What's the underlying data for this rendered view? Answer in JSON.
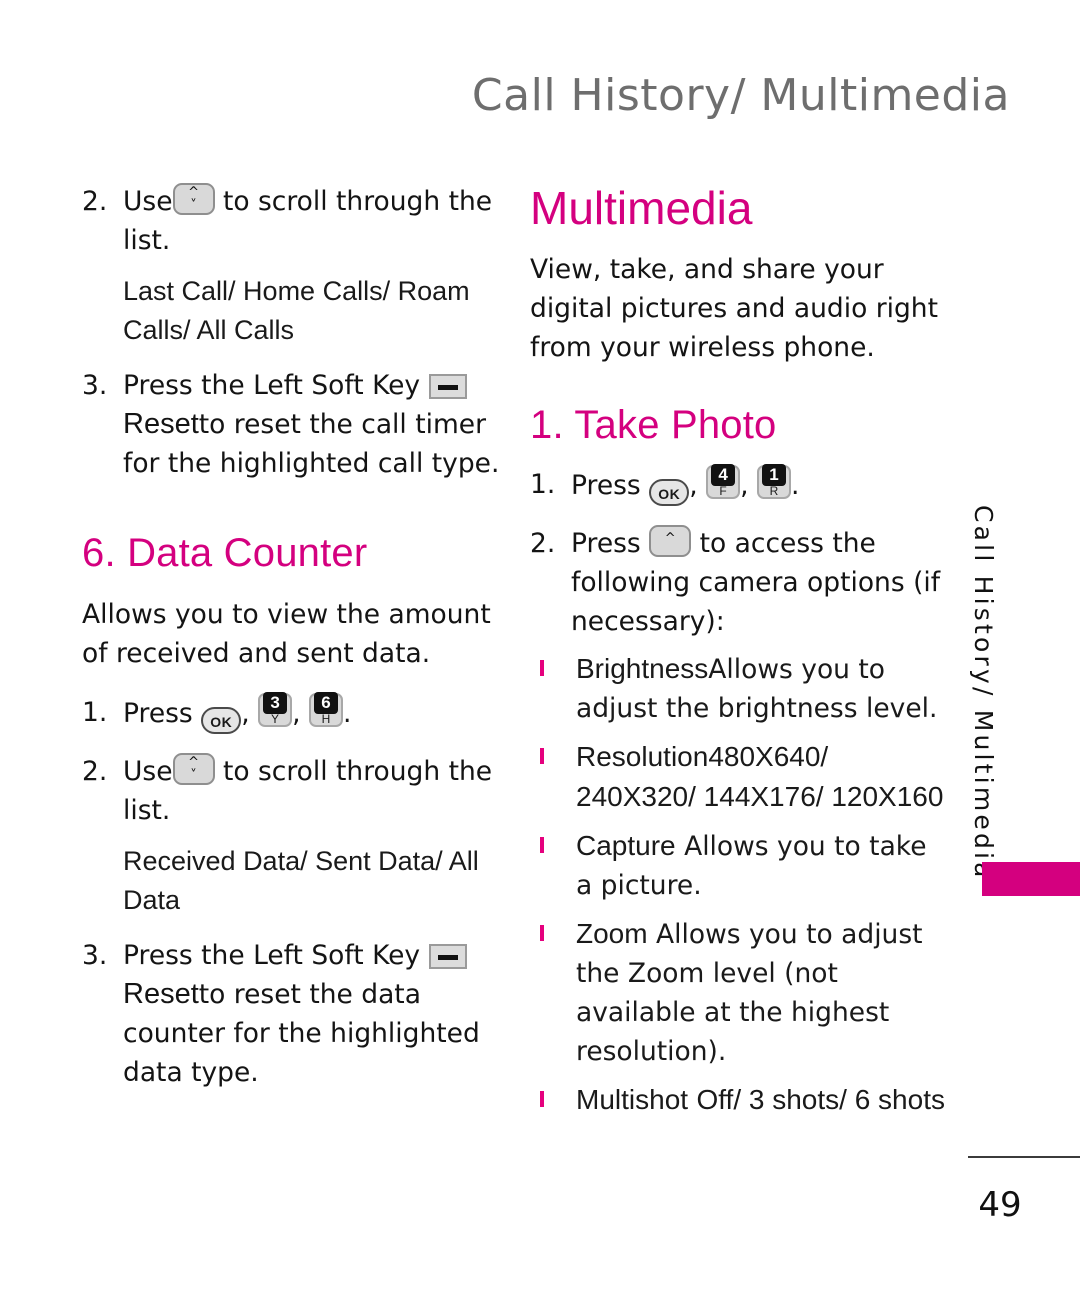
{
  "header": {
    "title": "Call History/ Multimedia"
  },
  "side_tab": {
    "label": "Call History/ Multimedia",
    "accent_color": "#D4007F"
  },
  "footer": {
    "page_number": "49"
  },
  "colors": {
    "accent_magenta": "#D4007F",
    "bullet_magenta": "#E5007E",
    "header_gray": "#6E6E6E",
    "body_black": "#141414"
  },
  "left_column": {
    "step2": {
      "num": "2.",
      "pre": "Use",
      "post": "to scroll through the list."
    },
    "call_types": "Last Call/ Home Calls/ Roam Calls/ All Calls",
    "step3": {
      "num": "3.",
      "pre": "Press the Left Soft Key",
      "bold": "Reset",
      "post": "to reset the call timer for the highlighted call type."
    },
    "data_counter_heading": "6. Data Counter",
    "data_counter_desc": "Allows you to view the amount of received and sent data.",
    "press_step": {
      "num": "1.",
      "label": "Press",
      "keys": [
        {
          "icon": "ok-key",
          "text": "OK"
        },
        {
          "icon": "numeric-key",
          "digit": "3",
          "letter": "Y"
        },
        {
          "icon": "numeric-key",
          "digit": "6",
          "letter": "H"
        }
      ],
      "trailing": "."
    },
    "scroll_step": {
      "num": "2.",
      "pre": "Use",
      "post": "to scroll through the list."
    },
    "data_types": "Received Data/ Sent Data/ All Data",
    "reset_step": {
      "num": "3.",
      "pre": "Press the Left Soft Key",
      "bold": "Reset",
      "post": "to reset the data counter for the highlighted data type."
    }
  },
  "right_column": {
    "multimedia_heading": "Multimedia",
    "multimedia_desc": "View, take, and share your digital pictures and audio right from your wireless phone.",
    "take_photo_heading": "1. Take Photo",
    "press_step": {
      "num": "1.",
      "label": "Press",
      "keys": [
        {
          "icon": "ok-key",
          "text": "OK"
        },
        {
          "icon": "numeric-key",
          "digit": "4",
          "letter": "F"
        },
        {
          "icon": "numeric-key",
          "digit": "1",
          "letter": "R"
        }
      ],
      "trailing": "."
    },
    "access_step": {
      "num": "2.",
      "pre": "Press",
      "post": "to access the following camera options (if necessary):"
    },
    "options": [
      {
        "term": "Brightness",
        "desc": "Allows you to adjust the brightness level.",
        "values": ""
      },
      {
        "term": "Resolution",
        "desc": "",
        "values": "480X640/ 240X320/ 144X176/ 120X160"
      },
      {
        "term": "Capture",
        "desc": "Allows you to take a picture.",
        "values": ""
      },
      {
        "term": "Zoom",
        "desc": "Allows you to adjust the Zoom level (not available at the highest resolution).",
        "values": ""
      },
      {
        "term": "Multishot",
        "desc": "",
        "values": "Off/ 3 shots/ 6 shots"
      }
    ]
  }
}
